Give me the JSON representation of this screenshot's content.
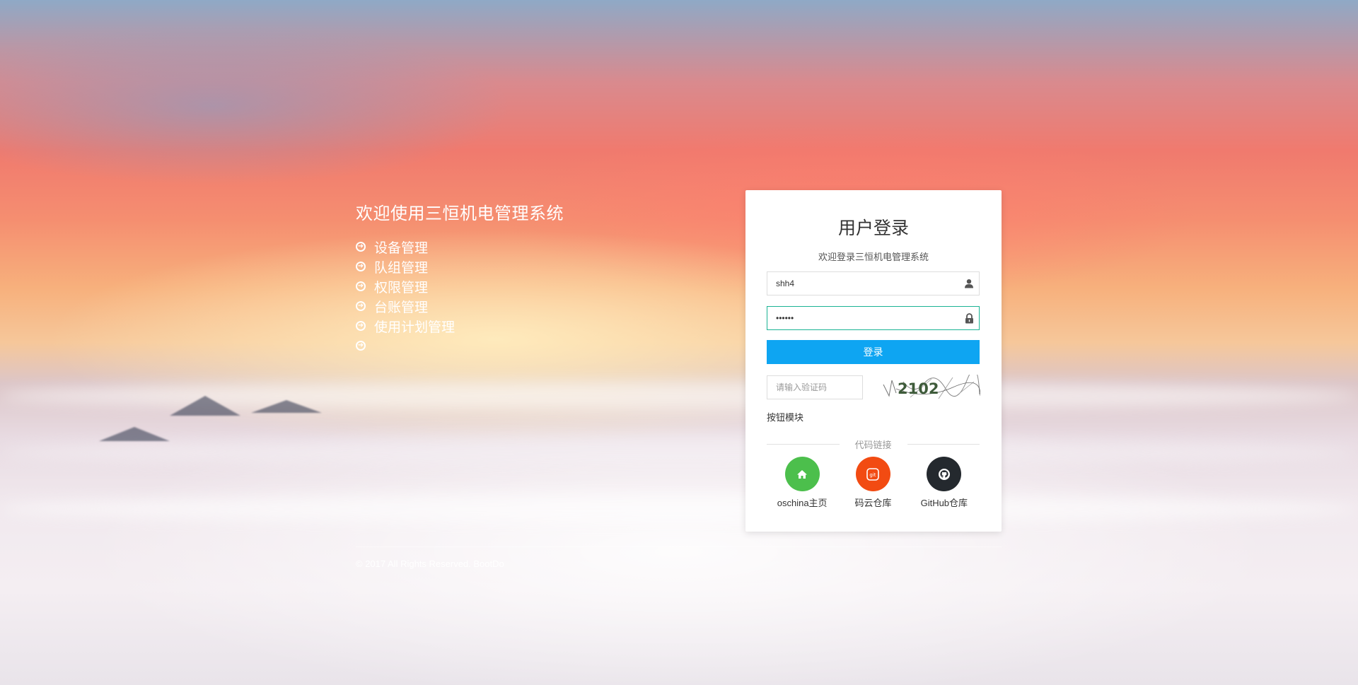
{
  "intro": {
    "title": "欢迎使用三恒机电管理系统",
    "features": [
      "设备管理",
      "队组管理",
      "权限管理",
      "台账管理",
      "使用计划管理",
      ""
    ]
  },
  "login": {
    "title": "用户登录",
    "subtitle": "欢迎登录三恒机电管理系统",
    "username_value": "shh4",
    "password_value": "••••••",
    "login_button_label": "登录",
    "captcha_placeholder": "请输入验证码",
    "captcha_text": "2102",
    "button_module_label": "按钮模块",
    "divider_label": "代码链接"
  },
  "links": [
    {
      "label": "oschina主页",
      "icon": "home-icon",
      "color": "#4cbf4c"
    },
    {
      "label": "码云仓库",
      "icon": "gitee-icon",
      "color": "#f24b12"
    },
    {
      "label": "GitHub仓库",
      "icon": "github-icon",
      "color": "#24292e"
    }
  ],
  "footer": {
    "copyright": "© 2017 All Rights Reserved. BootDo"
  },
  "colors": {
    "primary": "#0ea5f2",
    "focus_border": "#1ab394"
  }
}
